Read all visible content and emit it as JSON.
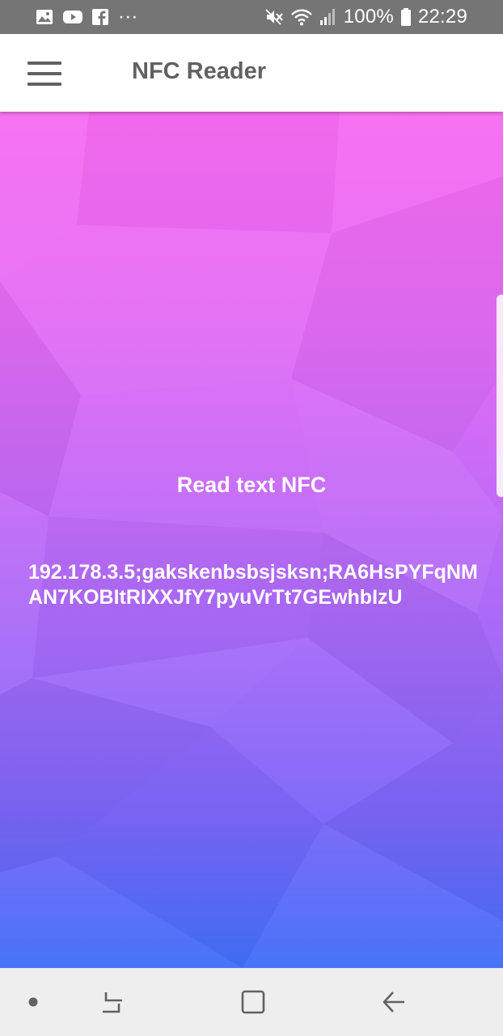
{
  "status_bar": {
    "icons_left": [
      "image-icon",
      "youtube-icon",
      "facebook-icon",
      "more-icon"
    ],
    "more_glyph": "···",
    "battery": "100%",
    "time": "22:29",
    "icons_right": [
      "mute-icon",
      "wifi-icon",
      "signal-icon",
      "battery-icon"
    ]
  },
  "app_bar": {
    "title": "NFC Reader",
    "menu_icon": "hamburger-menu-icon"
  },
  "main": {
    "heading": "Read text NFC",
    "value": "192.178.3.5;gakskenbsbsjsksn;RA6HsPYFqNMAN7KOBItRIXXJfY7pyuVrTt7GEwhbIzU"
  },
  "nav_bar": {
    "buttons": [
      "dot-icon",
      "recents-icon",
      "home-icon",
      "back-icon"
    ]
  },
  "colors": {
    "status_bar": "#757575",
    "app_bar": "#ffffff",
    "title_text": "#616161",
    "gradient_top": "#f76bf1",
    "gradient_bottom": "#3f6ff8",
    "nav_bar": "#eeeeee"
  }
}
